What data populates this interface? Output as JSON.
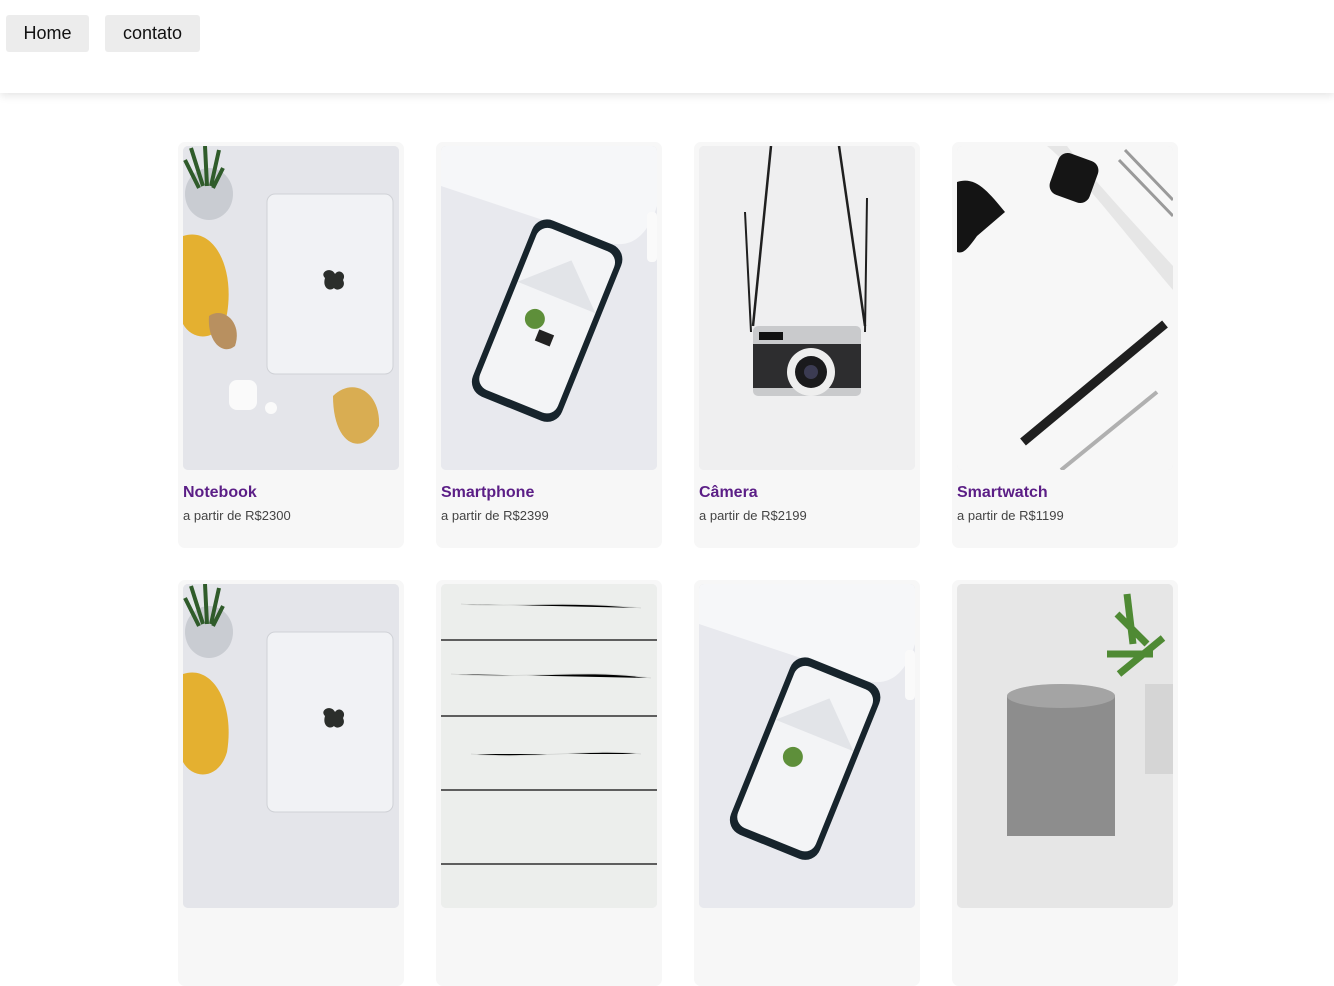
{
  "nav": {
    "home_label": "Home",
    "contato_label": "contato"
  },
  "products": [
    {
      "title": "Notebook",
      "price": "a partir de R$2300",
      "image": "laptop-photo"
    },
    {
      "title": "Smartphone",
      "price": "a partir de R$2399",
      "image": "smartphone-photo"
    },
    {
      "title": "Câmera",
      "price": "a partir de R$2199",
      "image": "camera-photo"
    },
    {
      "title": "Smartwatch",
      "price": "a partir de R$1199",
      "image": "smartwatch-photo"
    },
    {
      "title": "",
      "price": "",
      "image": "laptop-photo"
    },
    {
      "title": "",
      "price": "",
      "image": "wood-planks-photo"
    },
    {
      "title": "",
      "price": "",
      "image": "smartphone-photo"
    },
    {
      "title": "",
      "price": "",
      "image": "smart-speaker-photo"
    }
  ],
  "colors": {
    "title": "#5b1e86",
    "card_bg": "#f7f7f7",
    "nav_btn_bg": "#ececec"
  }
}
